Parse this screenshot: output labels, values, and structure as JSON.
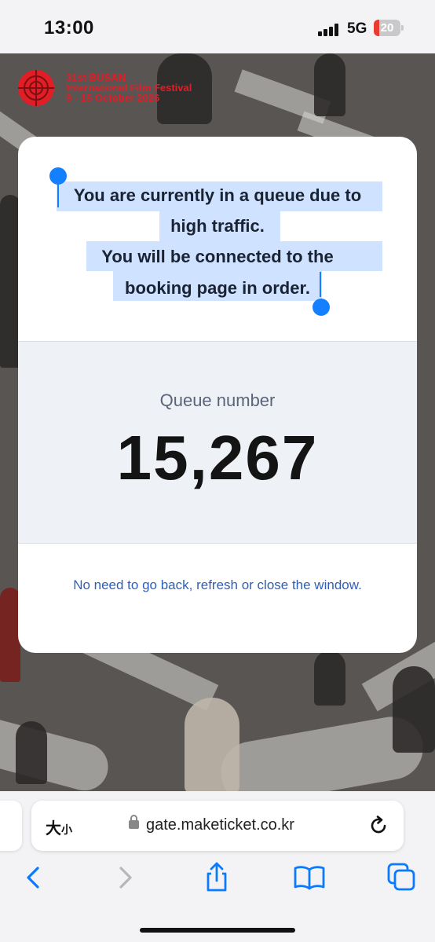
{
  "status_bar": {
    "time": "13:00",
    "network": "5G",
    "battery_level": "20",
    "battery_fraction": 0.2,
    "battery_color": "#ea3b32"
  },
  "festival": {
    "line1": "31st BUSAN",
    "line2": "International Film Festival",
    "line3": "9 - 15 October 2026",
    "brand_color": "#e11e26"
  },
  "queue_card": {
    "message_lines": [
      "You are currently in a queue due to",
      "high traffic.",
      "You will be connected to the",
      "booking page in order."
    ],
    "queue_label": "Queue number",
    "queue_number": "15,267",
    "notice": "No need to go back, refresh or close the window.",
    "selection_color": "#cfe2ff",
    "link_color": "#2f5fb8"
  },
  "browser": {
    "text_size_big": "大",
    "text_size_small": "小",
    "url": "gate.maketicket.co.kr",
    "lock_icon": "lock-icon",
    "reload_icon": "reload-icon",
    "toolbar": {
      "back_icon": "chevron-left-icon",
      "forward_icon": "chevron-right-icon",
      "share_icon": "share-icon",
      "bookmarks_icon": "book-icon",
      "tabs_icon": "tabs-icon"
    },
    "accent_color": "#0a7aff"
  }
}
